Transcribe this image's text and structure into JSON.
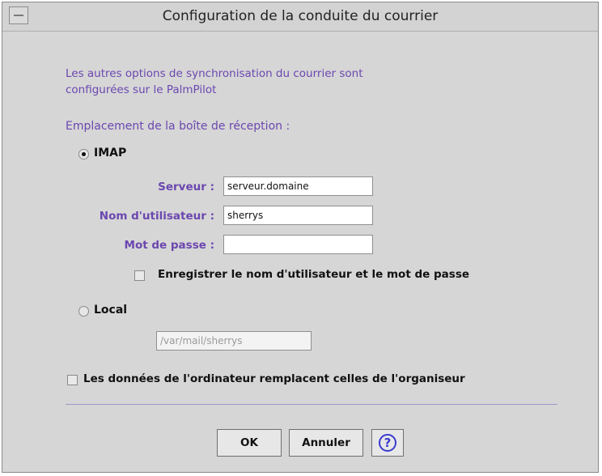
{
  "window": {
    "title": "Configuration de la conduite du courrier"
  },
  "info_text_line1": "Les autres options de synchronisation du courrier sont",
  "info_text_line2": "configurées sur le PalmPilot",
  "mailbox_label": "Emplacement de la boîte de réception :",
  "imap": {
    "label": "IMAP",
    "selected": true,
    "server_label": "Serveur :",
    "server_value": "serveur.domaine",
    "user_label": "Nom d'utilisateur :",
    "user_value": "sherrys",
    "password_label": "Mot de passe :",
    "password_value": "",
    "save_credentials_label": "Enregistrer le nom d'utilisateur et le mot de passe",
    "save_credentials_checked": false
  },
  "local": {
    "label": "Local",
    "selected": false,
    "path_value": "/var/mail/sherrys"
  },
  "override_label": "Les données de l'ordinateur remplacent celles de l'organiseur",
  "override_checked": false,
  "buttons": {
    "ok": "OK",
    "cancel": "Annuler",
    "help_icon": "help-icon"
  },
  "colors": {
    "accent_text": "#6b47b0",
    "help_icon": "#3b3bd0"
  }
}
